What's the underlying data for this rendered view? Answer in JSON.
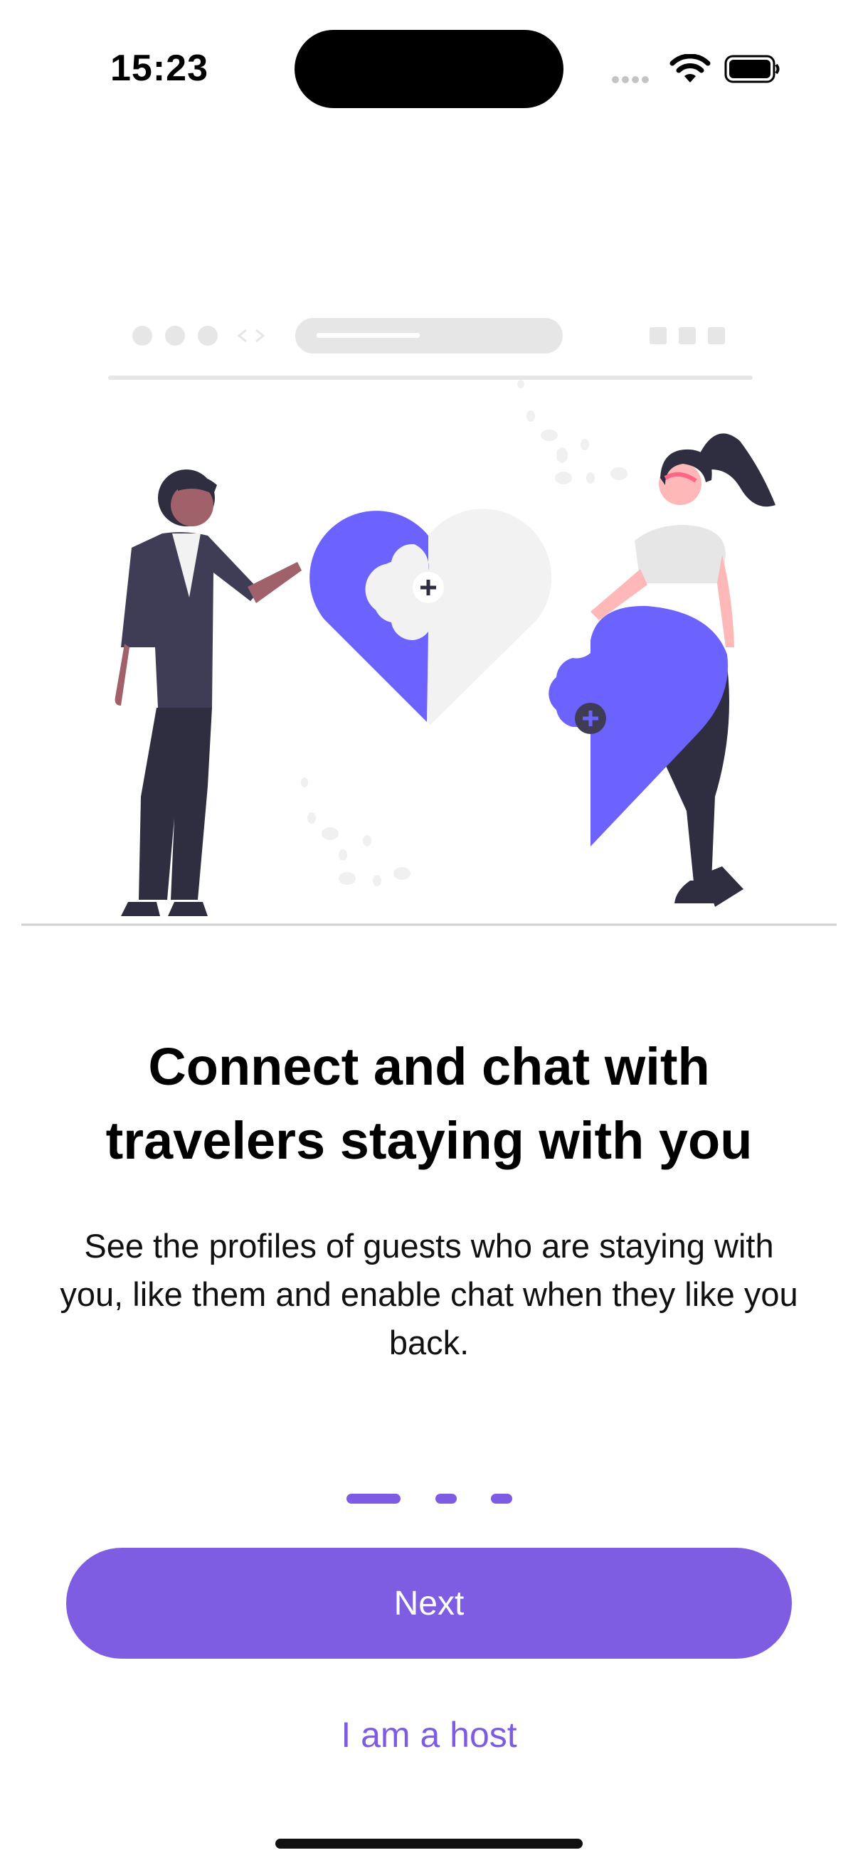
{
  "status_bar": {
    "time": "15:23",
    "icons": [
      "signal-dots-icon",
      "wifi-icon",
      "battery-icon"
    ]
  },
  "onboarding": {
    "illustration": "people-connecting-heart-puzzle-illustration",
    "headline": "Connect and chat with travelers staying with you",
    "body": "See the profiles of guests who are staying with you, like them and enable chat when they like you back.",
    "pager": {
      "pages": 3,
      "active": 1
    },
    "next_label": "Next",
    "host_label": "I am a host"
  },
  "colors": {
    "accent": "#7F5DE3",
    "illustration_accent": "#6C63FF",
    "dark": "#2F2E41",
    "background": "#FFFFFF"
  }
}
